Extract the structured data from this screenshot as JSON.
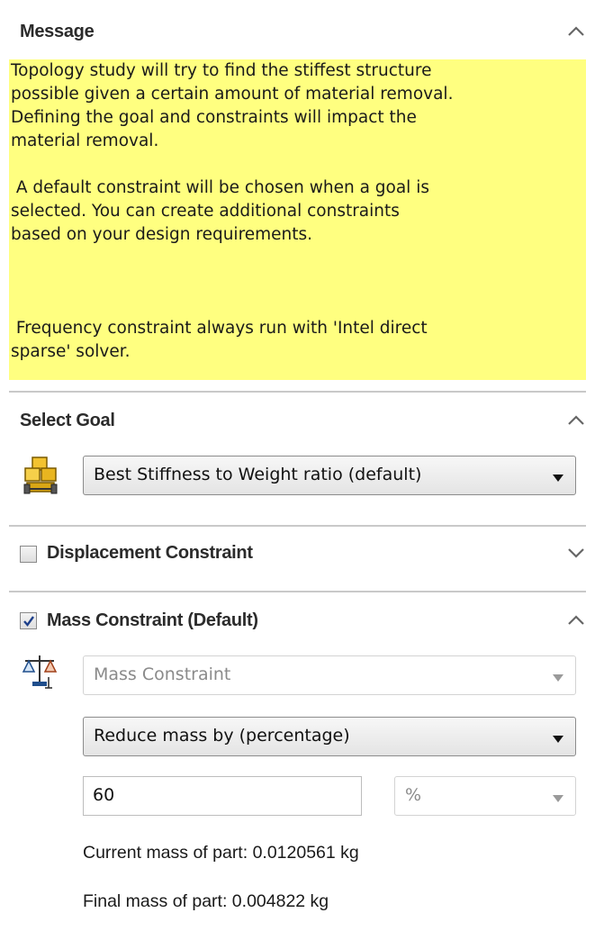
{
  "message": {
    "title": "Message",
    "paragraphs": [
      "Topology study will try to find the stiffest structure\npossible given a certain amount of material removal.\nDefining the goal and constraints will impact the\nmaterial removal.",
      " A default constraint will be chosen when a goal is\nselected. You can create additional constraints\nbased on your design requirements.",
      " Frequency constraint always run with 'Intel direct\nsparse' solver."
    ],
    "background_color": "#ffff80"
  },
  "select_goal": {
    "title": "Select Goal",
    "icon": "stiffness-blocks-icon",
    "selected": "Best Stiffness to Weight ratio (default)"
  },
  "displacement_constraint": {
    "title": "Displacement Constraint",
    "checked": false,
    "expanded": false
  },
  "mass_constraint": {
    "title": "Mass Constraint (Default)",
    "checked": true,
    "expanded": true,
    "icon": "mass-scale-icon",
    "constraint_type": "Mass Constraint",
    "reduce_mode": "Reduce mass by (percentage)",
    "value": "60",
    "unit": "%",
    "current_mass": "Current mass of part: 0.0120561 kg",
    "final_mass": "Final mass of part: 0.004822 kg"
  }
}
